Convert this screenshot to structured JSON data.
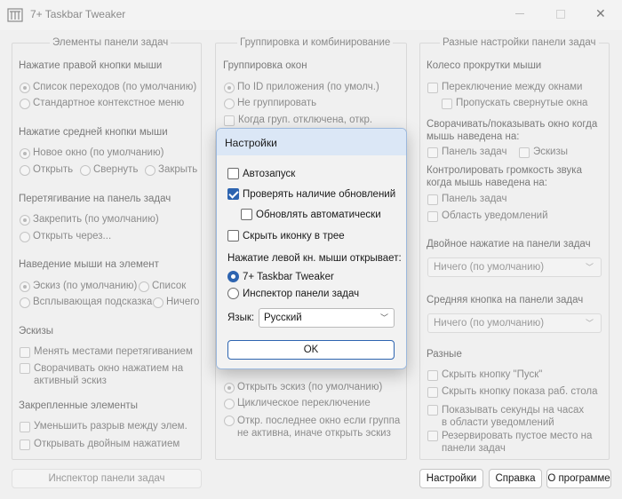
{
  "window": {
    "title": "7+ Taskbar Tweaker"
  },
  "left": {
    "header": "Элементы панели задач",
    "g1": {
      "title": "Нажатие правой кнопки мыши",
      "opt1": "Список переходов (по умолчанию)",
      "opt2": "Стандартное контекстное меню"
    },
    "g2": {
      "title": "Нажатие средней кнопки мыши",
      "opt1": "Новое окно (по умолчанию)",
      "opt2": "Открыть",
      "opt3": "Свернуть",
      "opt4": "Закрыть"
    },
    "g3": {
      "title": "Перетягивание на панель задач",
      "opt1": "Закрепить (по умолчанию)",
      "opt2": "Открыть через..."
    },
    "g4": {
      "title": "Наведение мыши на элемент",
      "opt1": "Эскиз (по умолчанию)",
      "opt2": "Список",
      "opt3": "Всплывающая подсказка",
      "opt4": "Ничего"
    },
    "g5": {
      "title": "Эскизы",
      "c1": "Менять местами перетягиванием",
      "c2a": "Сворачивать окно нажатием на",
      "c2b": "активный эскиз"
    },
    "g6": {
      "title": "Закрепленные элементы",
      "c1": "Уменьшить разрыв между элем.",
      "c2": "Открывать двойным нажатием"
    }
  },
  "middle": {
    "header": "Группировка и комбинирование",
    "g1": {
      "title": "Группировка окон",
      "opt1": "По ID приложения (по умолч.)",
      "opt2": "Не группировать",
      "c1": "Когда груп. отключена, откр."
    },
    "bottom": {
      "opt1": "Открыть эскиз (по умолчанию)",
      "opt2": "Циклическое переключение",
      "opt3a": "Откр. последнее окно если группа",
      "opt3b": "не активна, иначе открыть эскиз"
    }
  },
  "right": {
    "header": "Разные настройки панели задач",
    "g1": {
      "title": "Колесо прокрутки мыши",
      "c1": "Переключение между окнами",
      "c2": "Пропускать свернутые окна"
    },
    "g2": {
      "title_a": "Сворачивать/показывать окно когда",
      "title_b": "мышь наведена на:",
      "c1": "Панель задач",
      "c2": "Эскизы"
    },
    "g3": {
      "title_a": "Контролировать громкость звука",
      "title_b": "когда мышь наведена на:",
      "c1": "Панель задач",
      "c2": "Область уведомлений"
    },
    "g4": {
      "title": "Двойное нажатие на панели задач",
      "value": "Ничего (по умолчанию)"
    },
    "g5": {
      "title": "Средняя кнопка на панели задач",
      "value": "Ничего (по умолчанию)"
    },
    "g6": {
      "title": "Разные",
      "c1": "Скрыть кнопку \"Пуск\"",
      "c2": "Скрыть кнопку показа раб. стола",
      "c3a": "Показывать секунды на часах",
      "c3b": "в области уведомлений",
      "c4a": "Резервировать пустое место на",
      "c4b": "панели задач"
    }
  },
  "bottom_buttons": {
    "inspector": "Инспектор панели задач",
    "settings": "Настройки",
    "help": "Справка",
    "about": "О программе"
  },
  "dialog": {
    "title": "Настройки",
    "autostart": "Автозапуск",
    "check_updates": "Проверять наличие обновлений",
    "auto_update": "Обновлять автоматически",
    "hide_tray": "Скрыть иконку в трее",
    "left_click_label": "Нажатие левой кн. мыши открывает:",
    "radio1": "7+ Taskbar Tweaker",
    "radio2": "Инспектор панели задач",
    "lang_label": "Язык:",
    "lang_value": "Русский",
    "ok": "OK",
    "state": {
      "autostart": false,
      "check_updates": true,
      "auto_update": false,
      "hide_tray": false,
      "left_click_opens": "7+ Taskbar Tweaker"
    }
  },
  "colors": {
    "accent": "#2d64b0",
    "dialog_title_bg": "#dbe7f6",
    "window_bg": "#f0f0f0"
  }
}
